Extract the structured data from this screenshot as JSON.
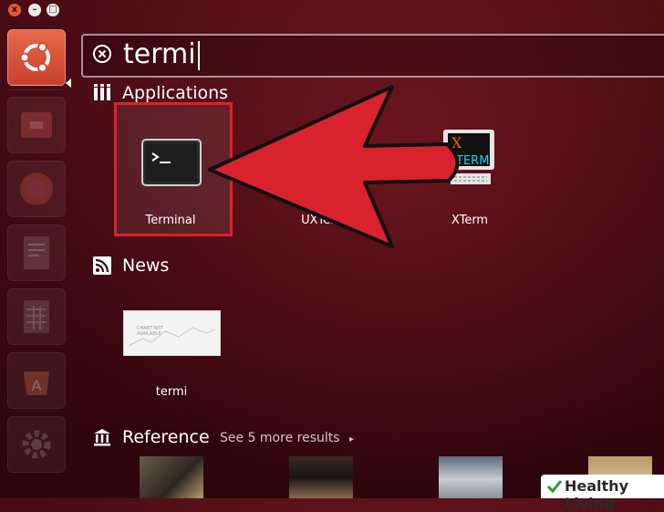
{
  "window": {
    "close_glyph": "x",
    "min_glyph": "–",
    "max_glyph": "□"
  },
  "launcher": {
    "items": [
      "dash-home",
      "files",
      "firefox",
      "writer",
      "calc",
      "software-center",
      "settings"
    ]
  },
  "search": {
    "value": "termi"
  },
  "applications": {
    "title": "Applications",
    "items": [
      {
        "label": "Terminal"
      },
      {
        "label": "UXTerm"
      },
      {
        "label": "XTerm"
      }
    ]
  },
  "news": {
    "title": "News",
    "item_label": "termi",
    "thumb_text": "CHART NOT AVAILABLE"
  },
  "reference": {
    "title": "Reference",
    "more": "See 5 more results"
  },
  "watermark": {
    "text": "Healthy Living"
  },
  "colors": {
    "highlight": "#e0202c",
    "arrow": "#d8222e",
    "background": "#3a0810"
  }
}
